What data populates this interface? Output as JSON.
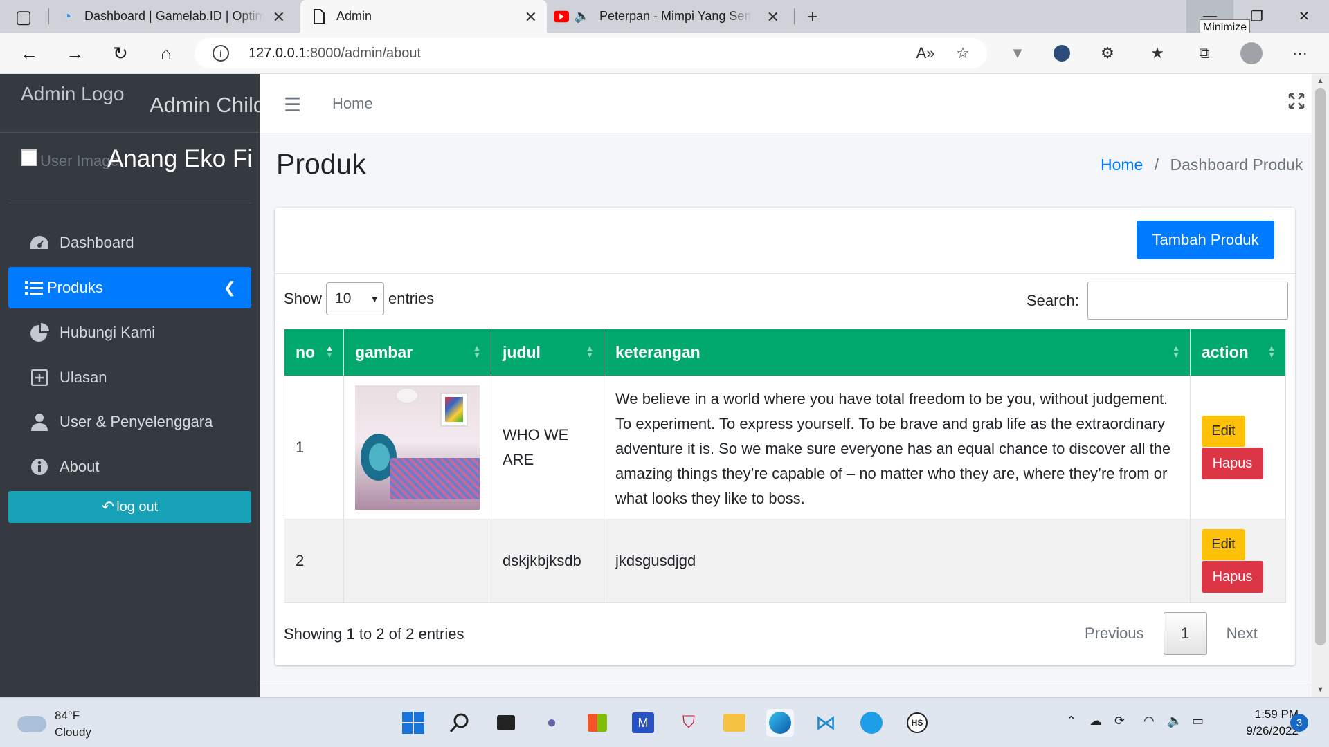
{
  "browser": {
    "tabs": [
      {
        "title": "Dashboard | Gamelab.ID | Optim",
        "active": false,
        "icon": "gamelab-icon"
      },
      {
        "title": "Admin",
        "active": true,
        "icon": "page-icon"
      },
      {
        "title": "Peterpan - Mimpi Yang Sem",
        "active": false,
        "icon": "youtube-icon"
      }
    ],
    "tooltip": "Minimize",
    "url_host": "127.0.0.1",
    "url_rest": ":8000/admin/about"
  },
  "sidebar": {
    "logo_alt": "Admin Logo",
    "brand": "Admin Child",
    "user_image_alt": "User Image",
    "user_name": "Anang Eko Fitr",
    "items": [
      {
        "label": "Dashboard",
        "icon": "dashboard-icon"
      },
      {
        "label": "Produks",
        "icon": "list-icon",
        "active": true
      },
      {
        "label": "Hubungi Kami",
        "icon": "pie-chart-icon"
      },
      {
        "label": "Ulasan",
        "icon": "plus-square-icon"
      },
      {
        "label": "User & Penyelenggara",
        "icon": "user-icon"
      },
      {
        "label": "About",
        "icon": "info-icon"
      }
    ],
    "logout": "log out"
  },
  "topnav": {
    "home": "Home"
  },
  "header": {
    "title": "Produk",
    "breadcrumb_home": "Home",
    "breadcrumb_sep": "/",
    "breadcrumb_current": "Dashboard Produk"
  },
  "card": {
    "add_button": "Tambah Produk",
    "show_label": "Show",
    "entries_value": "10",
    "entries_label": "entries",
    "search_label": "Search:",
    "columns": [
      "no",
      "gambar",
      "judul",
      "keterangan",
      "action"
    ],
    "rows": [
      {
        "no": "1",
        "judul": "WHO WE ARE",
        "keterangan": "We believe in a world where you have total freedom to be you, without judgement. To experiment. To express yourself. To be brave and grab life as the extraordinary adventure it is. So we make sure everyone has an equal chance to discover all the amazing things they’re capable of – no matter who they are, where they’re from or what looks they like to boss.",
        "has_image": true
      },
      {
        "no": "2",
        "judul": "dskjkbjksdb",
        "keterangan": "jkdsgusdjgd",
        "has_image": false
      }
    ],
    "edit_label": "Edit",
    "delete_label": "Hapus",
    "info": "Showing 1 to 2 of 2 entries",
    "previous": "Previous",
    "page": "1",
    "next": "Next"
  },
  "taskbar": {
    "temp": "84°F",
    "weather": "Cloudy",
    "time": "1:59 PM",
    "date": "9/26/2022",
    "notifications": "3"
  }
}
